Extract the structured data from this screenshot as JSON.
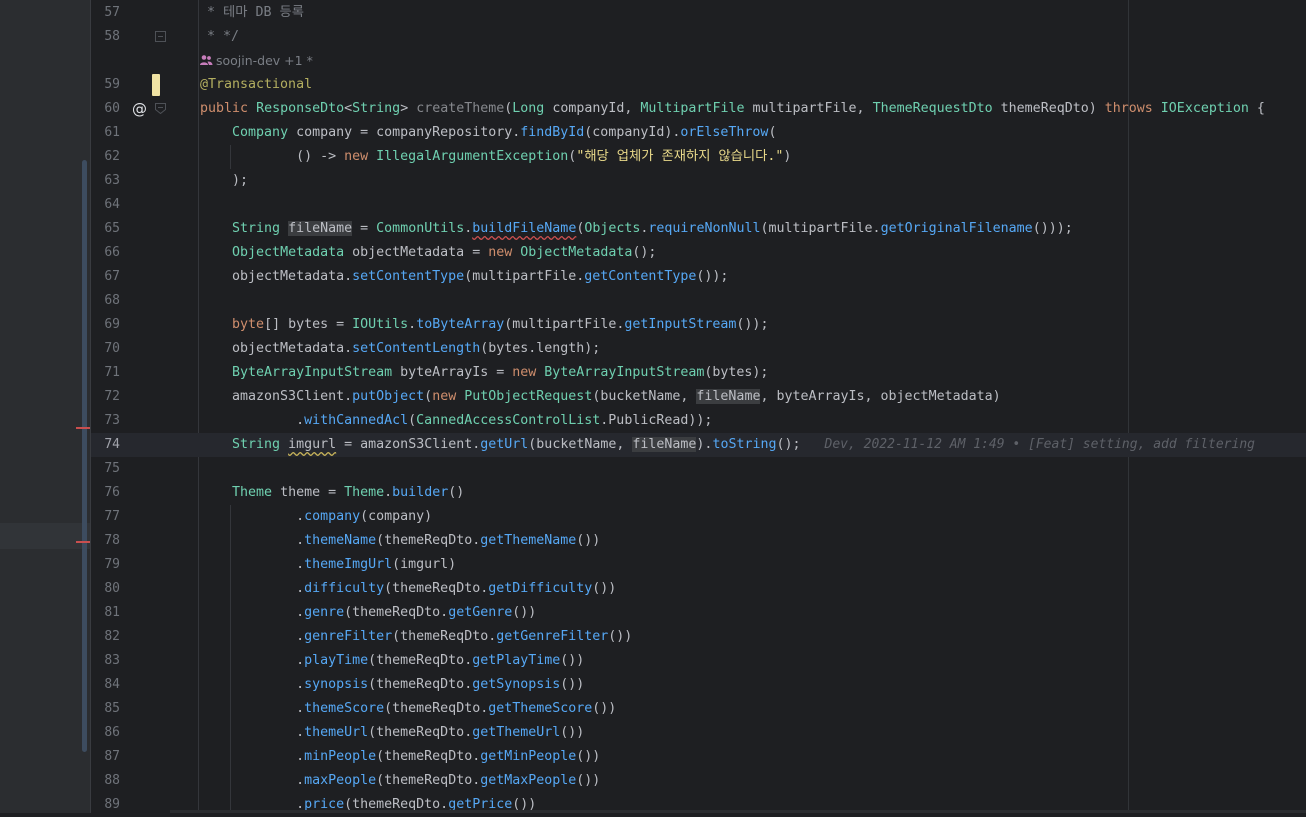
{
  "editor": {
    "author_lens": "soojin-dev +1 *",
    "blame_annotation": "Dev, 2022-11-12 AM 1:49 • [Feat] setting, add filtering",
    "lines": [
      {
        "n": "57",
        "text": " * 테마 DB 등록"
      },
      {
        "n": "58",
        "text": " * */"
      },
      {
        "n": "59",
        "text": "@Transactional"
      },
      {
        "n": "60",
        "text": "public ResponseDto<String> createTheme(Long companyId, MultipartFile multipartFile, ThemeRequestDto themeReqDto) throws IOException {"
      },
      {
        "n": "61",
        "text": "    Company company = companyRepository.findById(companyId).orElseThrow("
      },
      {
        "n": "62",
        "text": "            () -> new IllegalArgumentException(\"해당 업체가 존재하지 않습니다.\")"
      },
      {
        "n": "63",
        "text": "    );"
      },
      {
        "n": "64",
        "text": ""
      },
      {
        "n": "65",
        "text": "    String fileName = CommonUtils.buildFileName(Objects.requireNonNull(multipartFile.getOriginalFilename()));"
      },
      {
        "n": "66",
        "text": "    ObjectMetadata objectMetadata = new ObjectMetadata();"
      },
      {
        "n": "67",
        "text": "    objectMetadata.setContentType(multipartFile.getContentType());"
      },
      {
        "n": "68",
        "text": ""
      },
      {
        "n": "69",
        "text": "    byte[] bytes = IOUtils.toByteArray(multipartFile.getInputStream());"
      },
      {
        "n": "70",
        "text": "    objectMetadata.setContentLength(bytes.length);"
      },
      {
        "n": "71",
        "text": "    ByteArrayInputStream byteArrayIs = new ByteArrayInputStream(bytes);"
      },
      {
        "n": "72",
        "text": "    amazonS3Client.putObject(new PutObjectRequest(bucketName, fileName, byteArrayIs, objectMetadata)"
      },
      {
        "n": "73",
        "text": "            .withCannedAcl(CannedAccessControlList.PublicRead));"
      },
      {
        "n": "74",
        "text": "    String imgurl = amazonS3Client.getUrl(bucketName, fileName).toString();"
      },
      {
        "n": "75",
        "text": ""
      },
      {
        "n": "76",
        "text": "    Theme theme = Theme.builder()"
      },
      {
        "n": "77",
        "text": "            .company(company)"
      },
      {
        "n": "78",
        "text": "            .themeName(themeReqDto.getThemeName())"
      },
      {
        "n": "79",
        "text": "            .themeImgUrl(imgurl)"
      },
      {
        "n": "80",
        "text": "            .difficulty(themeReqDto.getDifficulty())"
      },
      {
        "n": "81",
        "text": "            .genre(themeReqDto.getGenre())"
      },
      {
        "n": "82",
        "text": "            .genreFilter(themeReqDto.getGenreFilter())"
      },
      {
        "n": "83",
        "text": "            .playTime(themeReqDto.getPlayTime())"
      },
      {
        "n": "84",
        "text": "            .synopsis(themeReqDto.getSynopsis())"
      },
      {
        "n": "85",
        "text": "            .themeScore(themeReqDto.getThemeScore())"
      },
      {
        "n": "86",
        "text": "            .themeUrl(themeReqDto.getThemeUrl())"
      },
      {
        "n": "87",
        "text": "            .minPeople(themeReqDto.getMinPeople())"
      },
      {
        "n": "88",
        "text": "            .maxPeople(themeReqDto.getMaxPeople())"
      },
      {
        "n": "89",
        "text": "            .price(themeReqDto.getPrice())"
      }
    ],
    "current_line": "74",
    "colors": {
      "background": "#1e1f22",
      "keyword": "#cf8e6d",
      "type": "#6fd0b0",
      "method": "#56a8f5",
      "annotation": "#b3ae60",
      "comment": "#7a7e85",
      "string": "#e8d98a",
      "vcs_modified": "#f0e3a4"
    },
    "gutter_icons": [
      "at-icon",
      "fold-icon",
      "vcs-change-marker"
    ]
  }
}
